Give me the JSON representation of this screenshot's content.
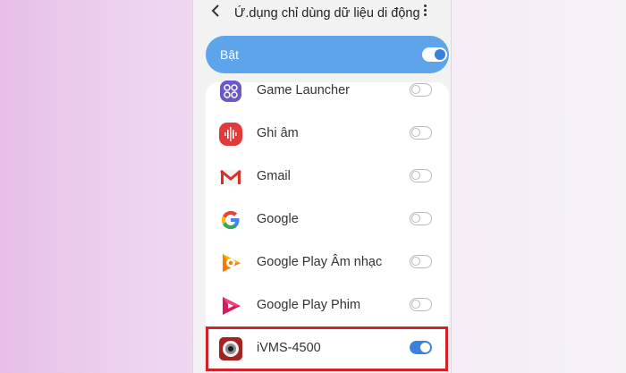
{
  "header": {
    "back_icon": "chevron-left-icon",
    "title": "Ứ.dụng chỉ dùng dữ liệu di động",
    "more_icon": "vertical-dots-icon"
  },
  "master_toggle": {
    "label": "Bật",
    "on": true
  },
  "apps": [
    {
      "name": "Game Launcher",
      "icon": "game-launcher-icon",
      "on": false
    },
    {
      "name": "Ghi âm",
      "icon": "voice-recorder-icon",
      "on": false
    },
    {
      "name": "Gmail",
      "icon": "gmail-icon",
      "on": false
    },
    {
      "name": "Google",
      "icon": "google-icon",
      "on": false
    },
    {
      "name": "Google Play Âm nhạc",
      "icon": "google-play-music-icon",
      "on": false
    },
    {
      "name": "Google Play Phim",
      "icon": "google-play-movies-icon",
      "on": false
    },
    {
      "name": "iVMS-4500",
      "icon": "ivms-icon",
      "on": true
    }
  ],
  "colors": {
    "accent": "#3b82e0",
    "banner": "#5ea4ea",
    "highlight": "#d4202a"
  }
}
